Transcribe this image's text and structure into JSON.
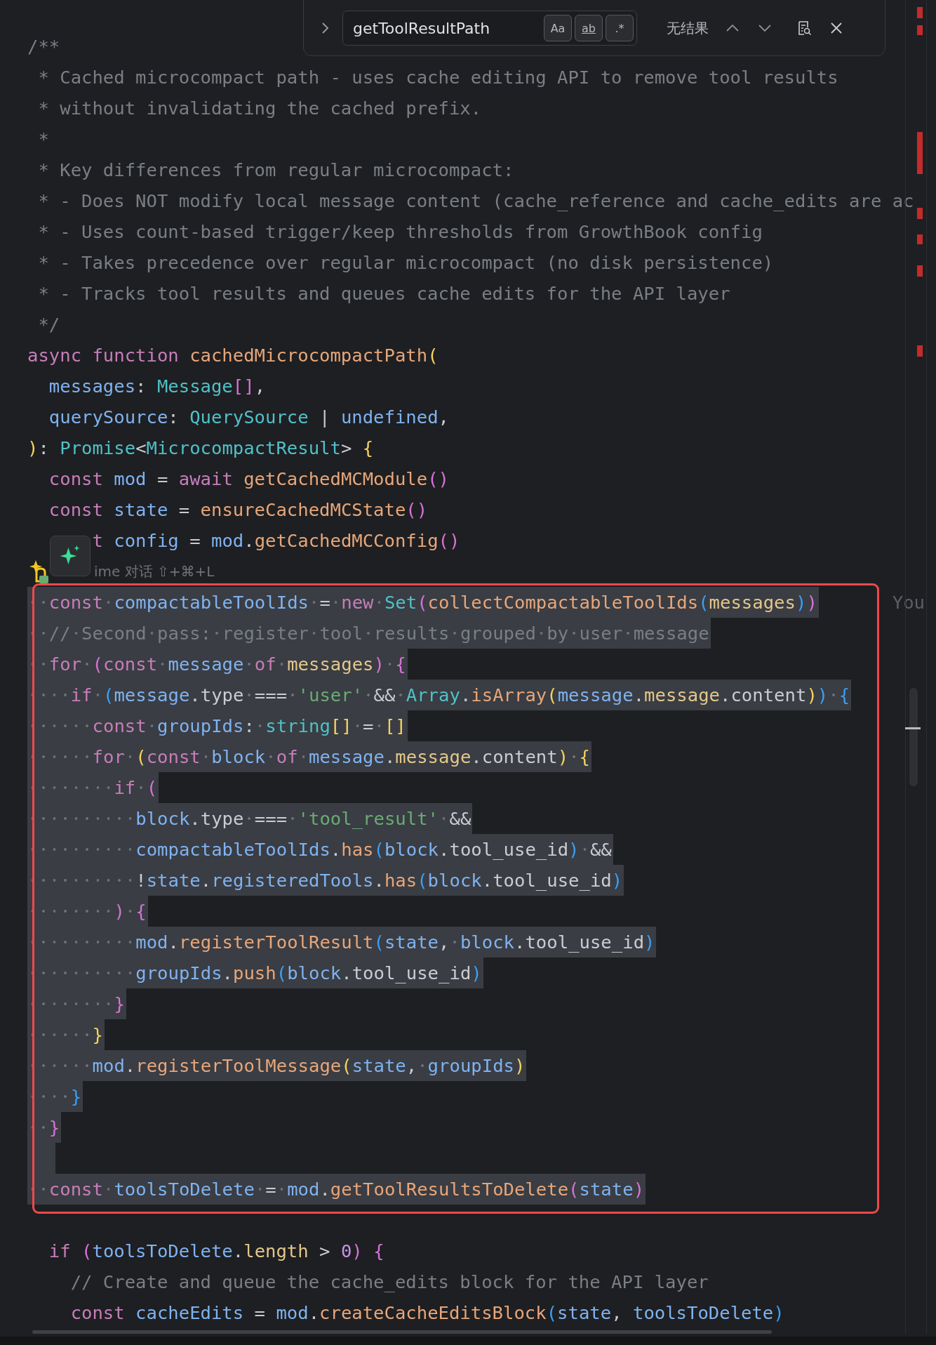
{
  "search": {
    "value": "getToolResultPath",
    "options": [
      {
        "label": "Aa",
        "kind": "case",
        "on": false
      },
      {
        "label": "ab",
        "kind": "word",
        "on": false
      },
      {
        "label": ".*",
        "kind": "regex",
        "on": false
      }
    ],
    "status": "无结果"
  },
  "lines": [
    {
      "kind": "code",
      "selected": false,
      "tokens": [
        {
          "text": "/**",
          "kind": "cmt"
        }
      ]
    },
    {
      "kind": "code",
      "selected": false,
      "tokens": [
        {
          "text": " * Cached microcompact path - uses cache editing API to remove tool results",
          "kind": "cmt"
        }
      ]
    },
    {
      "kind": "code",
      "selected": false,
      "tokens": [
        {
          "text": " * without invalidating the cached prefix.",
          "kind": "cmt"
        }
      ]
    },
    {
      "kind": "code",
      "selected": false,
      "tokens": [
        {
          "text": " *",
          "kind": "cmt"
        }
      ]
    },
    {
      "kind": "code",
      "selected": false,
      "tokens": [
        {
          "text": " * Key differences from regular microcompact:",
          "kind": "cmt"
        }
      ]
    },
    {
      "kind": "code",
      "selected": false,
      "tokens": [
        {
          "text": " * - Does NOT modify local message content (cache_reference and cache_edits are ac",
          "kind": "cmt"
        }
      ]
    },
    {
      "kind": "code",
      "selected": false,
      "tokens": [
        {
          "text": " * - Uses count-based trigger/keep thresholds from GrowthBook config",
          "kind": "cmt"
        }
      ]
    },
    {
      "kind": "code",
      "selected": false,
      "tokens": [
        {
          "text": " * - Takes precedence over regular microcompact (no disk persistence)",
          "kind": "cmt"
        }
      ]
    },
    {
      "kind": "code",
      "selected": false,
      "tokens": [
        {
          "text": " * - Tracks tool results and queues cache edits for the API layer",
          "kind": "cmt"
        }
      ]
    },
    {
      "kind": "code",
      "selected": false,
      "tokens": [
        {
          "text": " */",
          "kind": "cmt"
        }
      ]
    },
    {
      "kind": "code",
      "selected": false,
      "tokens": [
        {
          "text": "async function ",
          "kind": "kw"
        },
        {
          "text": "cachedMicrocompactPath",
          "kind": "fn"
        },
        {
          "text": "(",
          "kind": "b1"
        }
      ]
    },
    {
      "kind": "code",
      "selected": false,
      "tokens": [
        {
          "text": "  messages",
          "kind": "var"
        },
        {
          "text": ": ",
          "kind": "op"
        },
        {
          "text": "Message",
          "kind": "type"
        },
        {
          "text": "[]",
          "kind": "b2"
        },
        {
          "text": ",",
          "kind": "op"
        }
      ]
    },
    {
      "kind": "code",
      "selected": false,
      "tokens": [
        {
          "text": "  querySource",
          "kind": "var"
        },
        {
          "text": ": ",
          "kind": "op"
        },
        {
          "text": "QuerySource",
          "kind": "type"
        },
        {
          "text": " | ",
          "kind": "op"
        },
        {
          "text": "undefined",
          "kind": "var"
        },
        {
          "text": ",",
          "kind": "op"
        }
      ]
    },
    {
      "kind": "code",
      "selected": false,
      "tokens": [
        {
          "text": ")",
          "kind": "b1"
        },
        {
          "text": ": ",
          "kind": "op"
        },
        {
          "text": "Promise",
          "kind": "type"
        },
        {
          "text": "<",
          "kind": "op"
        },
        {
          "text": "MicrocompactResult",
          "kind": "type"
        },
        {
          "text": "> ",
          "kind": "op"
        },
        {
          "text": "{",
          "kind": "b1"
        }
      ]
    },
    {
      "kind": "code",
      "selected": false,
      "tokens": [
        {
          "text": "  const ",
          "kind": "kw"
        },
        {
          "text": "mod",
          "kind": "var"
        },
        {
          "text": " = ",
          "kind": "op"
        },
        {
          "text": "await ",
          "kind": "kw"
        },
        {
          "text": "getCachedMCModule",
          "kind": "fn"
        },
        {
          "text": "()",
          "kind": "b2"
        }
      ]
    },
    {
      "kind": "code",
      "selected": false,
      "tokens": [
        {
          "text": "  const ",
          "kind": "kw"
        },
        {
          "text": "state",
          "kind": "var"
        },
        {
          "text": " = ",
          "kind": "op"
        },
        {
          "text": "ensureCachedMCState",
          "kind": "fn"
        },
        {
          "text": "()",
          "kind": "b2"
        }
      ]
    },
    {
      "kind": "code",
      "selected": false,
      "tokens": [
        {
          "text": "      t ",
          "kind": "kw"
        },
        {
          "text": "config",
          "kind": "var"
        },
        {
          "text": " = ",
          "kind": "op"
        },
        {
          "text": "mod",
          "kind": "var"
        },
        {
          "text": ".",
          "kind": "op"
        },
        {
          "text": "getCachedMCConfig",
          "kind": "fn"
        },
        {
          "text": "()",
          "kind": "b2"
        }
      ]
    },
    {
      "kind": "hint",
      "text": "ime 对话 ⇧+⌘+L"
    },
    {
      "kind": "code",
      "selected": true,
      "ghost": "You",
      "tokens": [
        {
          "text": "  const ",
          "kind": "kw"
        },
        {
          "text": "compactableToolIds",
          "kind": "var"
        },
        {
          "text": " = ",
          "kind": "op"
        },
        {
          "text": "new ",
          "kind": "kw"
        },
        {
          "text": "Set",
          "kind": "type"
        },
        {
          "text": "(",
          "kind": "b2"
        },
        {
          "text": "collectCompactableToolIds",
          "kind": "fn"
        },
        {
          "text": "(",
          "kind": "b3"
        },
        {
          "text": "messages",
          "kind": "arg"
        },
        {
          "text": ")",
          "kind": "b3"
        },
        {
          "text": ")",
          "kind": "b2"
        }
      ]
    },
    {
      "kind": "code",
      "selected": true,
      "tokens": [
        {
          "text": "  // Second pass: register tool results grouped by user message",
          "kind": "cmt"
        }
      ]
    },
    {
      "kind": "code",
      "selected": true,
      "tokens": [
        {
          "text": "  for ",
          "kind": "kw"
        },
        {
          "text": "(",
          "kind": "b2"
        },
        {
          "text": "const ",
          "kind": "kw"
        },
        {
          "text": "message ",
          "kind": "var"
        },
        {
          "text": "of ",
          "kind": "kw"
        },
        {
          "text": "messages",
          "kind": "arg"
        },
        {
          "text": ")",
          "kind": "b2"
        },
        {
          "text": " {",
          "kind": "b2"
        }
      ]
    },
    {
      "kind": "code",
      "selected": true,
      "tokens": [
        {
          "text": "    if ",
          "kind": "kw"
        },
        {
          "text": "(",
          "kind": "b3"
        },
        {
          "text": "message",
          "kind": "var"
        },
        {
          "text": ".type === ",
          "kind": "op"
        },
        {
          "text": "'user'",
          "kind": "str"
        },
        {
          "text": " && ",
          "kind": "op"
        },
        {
          "text": "Array",
          "kind": "type"
        },
        {
          "text": ".",
          "kind": "op"
        },
        {
          "text": "isArray",
          "kind": "fn"
        },
        {
          "text": "(",
          "kind": "b1"
        },
        {
          "text": "message",
          "kind": "var"
        },
        {
          "text": ".",
          "kind": "op"
        },
        {
          "text": "message",
          "kind": "arg"
        },
        {
          "text": ".content",
          "kind": "op"
        },
        {
          "text": ")",
          "kind": "b1"
        },
        {
          "text": ")",
          "kind": "b3"
        },
        {
          "text": " {",
          "kind": "b3"
        }
      ]
    },
    {
      "kind": "code",
      "selected": true,
      "tokens": [
        {
          "text": "      const ",
          "kind": "kw"
        },
        {
          "text": "groupIds",
          "kind": "var"
        },
        {
          "text": ": ",
          "kind": "op"
        },
        {
          "text": "string",
          "kind": "type"
        },
        {
          "text": "[]",
          "kind": "b1"
        },
        {
          "text": " = ",
          "kind": "op"
        },
        {
          "text": "[]",
          "kind": "b1"
        }
      ]
    },
    {
      "kind": "code",
      "selected": true,
      "tokens": [
        {
          "text": "      for ",
          "kind": "kw"
        },
        {
          "text": "(",
          "kind": "b1"
        },
        {
          "text": "const ",
          "kind": "kw"
        },
        {
          "text": "block ",
          "kind": "var"
        },
        {
          "text": "of ",
          "kind": "kw"
        },
        {
          "text": "message",
          "kind": "var"
        },
        {
          "text": ".",
          "kind": "op"
        },
        {
          "text": "message",
          "kind": "arg"
        },
        {
          "text": ".content",
          "kind": "op"
        },
        {
          "text": ")",
          "kind": "b1"
        },
        {
          "text": " {",
          "kind": "b1"
        }
      ]
    },
    {
      "kind": "code",
      "selected": true,
      "tokens": [
        {
          "text": "        if ",
          "kind": "kw"
        },
        {
          "text": "(",
          "kind": "b2"
        }
      ]
    },
    {
      "kind": "code",
      "selected": true,
      "tokens": [
        {
          "text": "          block",
          "kind": "var"
        },
        {
          "text": ".type === ",
          "kind": "op"
        },
        {
          "text": "'tool_result'",
          "kind": "str"
        },
        {
          "text": " &&",
          "kind": "op"
        }
      ]
    },
    {
      "kind": "code",
      "selected": true,
      "tokens": [
        {
          "text": "          compactableToolIds",
          "kind": "var"
        },
        {
          "text": ".",
          "kind": "op"
        },
        {
          "text": "has",
          "kind": "fn"
        },
        {
          "text": "(",
          "kind": "b3"
        },
        {
          "text": "block",
          "kind": "var"
        },
        {
          "text": ".tool_use_id",
          "kind": "op"
        },
        {
          "text": ")",
          "kind": "b3"
        },
        {
          "text": " &&",
          "kind": "op"
        }
      ]
    },
    {
      "kind": "code",
      "selected": true,
      "tokens": [
        {
          "text": "          !",
          "kind": "op"
        },
        {
          "text": "state",
          "kind": "var"
        },
        {
          "text": ".",
          "kind": "op"
        },
        {
          "text": "registeredTools",
          "kind": "var"
        },
        {
          "text": ".",
          "kind": "op"
        },
        {
          "text": "has",
          "kind": "fn"
        },
        {
          "text": "(",
          "kind": "b3"
        },
        {
          "text": "block",
          "kind": "var"
        },
        {
          "text": ".tool_use_id",
          "kind": "op"
        },
        {
          "text": ")",
          "kind": "b3"
        }
      ]
    },
    {
      "kind": "code",
      "selected": true,
      "tokens": [
        {
          "text": "        )",
          "kind": "b2"
        },
        {
          "text": " {",
          "kind": "b2"
        }
      ]
    },
    {
      "kind": "code",
      "selected": true,
      "tokens": [
        {
          "text": "          mod",
          "kind": "var"
        },
        {
          "text": ".",
          "kind": "op"
        },
        {
          "text": "registerToolResult",
          "kind": "fn"
        },
        {
          "text": "(",
          "kind": "b3"
        },
        {
          "text": "state",
          "kind": "var"
        },
        {
          "text": ", ",
          "kind": "op"
        },
        {
          "text": "block",
          "kind": "var"
        },
        {
          "text": ".tool_use_id",
          "kind": "op"
        },
        {
          "text": ")",
          "kind": "b3"
        }
      ]
    },
    {
      "kind": "code",
      "selected": true,
      "tokens": [
        {
          "text": "          groupIds",
          "kind": "var"
        },
        {
          "text": ".",
          "kind": "op"
        },
        {
          "text": "push",
          "kind": "fn"
        },
        {
          "text": "(",
          "kind": "b3"
        },
        {
          "text": "block",
          "kind": "var"
        },
        {
          "text": ".tool_use_id",
          "kind": "op"
        },
        {
          "text": ")",
          "kind": "b3"
        }
      ]
    },
    {
      "kind": "code",
      "selected": true,
      "tokens": [
        {
          "text": "        }",
          "kind": "b2"
        }
      ]
    },
    {
      "kind": "code",
      "selected": true,
      "tokens": [
        {
          "text": "      }",
          "kind": "b1"
        }
      ]
    },
    {
      "kind": "code",
      "selected": true,
      "tokens": [
        {
          "text": "      mod",
          "kind": "var"
        },
        {
          "text": ".",
          "kind": "op"
        },
        {
          "text": "registerToolMessage",
          "kind": "fn"
        },
        {
          "text": "(",
          "kind": "b1"
        },
        {
          "text": "state",
          "kind": "var"
        },
        {
          "text": ", ",
          "kind": "op"
        },
        {
          "text": "groupIds",
          "kind": "var"
        },
        {
          "text": ")",
          "kind": "b1"
        }
      ]
    },
    {
      "kind": "code",
      "selected": true,
      "tokens": [
        {
          "text": "    }",
          "kind": "b3"
        }
      ]
    },
    {
      "kind": "code",
      "selected": true,
      "tokens": [
        {
          "text": "  }",
          "kind": "b2"
        }
      ]
    },
    {
      "kind": "code",
      "selected": true
    },
    {
      "kind": "code",
      "selected": true,
      "tokens": [
        {
          "text": "  const ",
          "kind": "kw"
        },
        {
          "text": "toolsToDelete",
          "kind": "var"
        },
        {
          "text": " = ",
          "kind": "op"
        },
        {
          "text": "mod",
          "kind": "var"
        },
        {
          "text": ".",
          "kind": "op"
        },
        {
          "text": "getToolResultsToDelete",
          "kind": "fn"
        },
        {
          "text": "(",
          "kind": "b2"
        },
        {
          "text": "state",
          "kind": "var"
        },
        {
          "text": ")",
          "kind": "b2"
        }
      ]
    },
    {
      "kind": "code",
      "selected": false
    },
    {
      "kind": "code",
      "selected": false,
      "tokens": [
        {
          "text": "  if ",
          "kind": "kw"
        },
        {
          "text": "(",
          "kind": "b2"
        },
        {
          "text": "toolsToDelete",
          "kind": "var"
        },
        {
          "text": ".",
          "kind": "op"
        },
        {
          "text": "length",
          "kind": "arg"
        },
        {
          "text": " > ",
          "kind": "op"
        },
        {
          "text": "0",
          "kind": "num"
        },
        {
          "text": ")",
          "kind": "b2"
        },
        {
          "text": " {",
          "kind": "b2"
        }
      ]
    },
    {
      "kind": "code",
      "selected": false,
      "tokens": [
        {
          "text": "    // Create and queue the cache_edits block for the API layer",
          "kind": "cmt"
        }
      ]
    },
    {
      "kind": "code",
      "selected": false,
      "tokens": [
        {
          "text": "    const ",
          "kind": "kw"
        },
        {
          "text": "cacheEdits",
          "kind": "var"
        },
        {
          "text": " = ",
          "kind": "op"
        },
        {
          "text": "mod",
          "kind": "var"
        },
        {
          "text": ".",
          "kind": "op"
        },
        {
          "text": "createCacheEditsBlock",
          "kind": "fn"
        },
        {
          "text": "(",
          "kind": "b3"
        },
        {
          "text": "state",
          "kind": "var"
        },
        {
          "text": ", ",
          "kind": "op"
        },
        {
          "text": "toolsToDelete",
          "kind": "var"
        },
        {
          "text": ")",
          "kind": "b3"
        }
      ]
    }
  ]
}
